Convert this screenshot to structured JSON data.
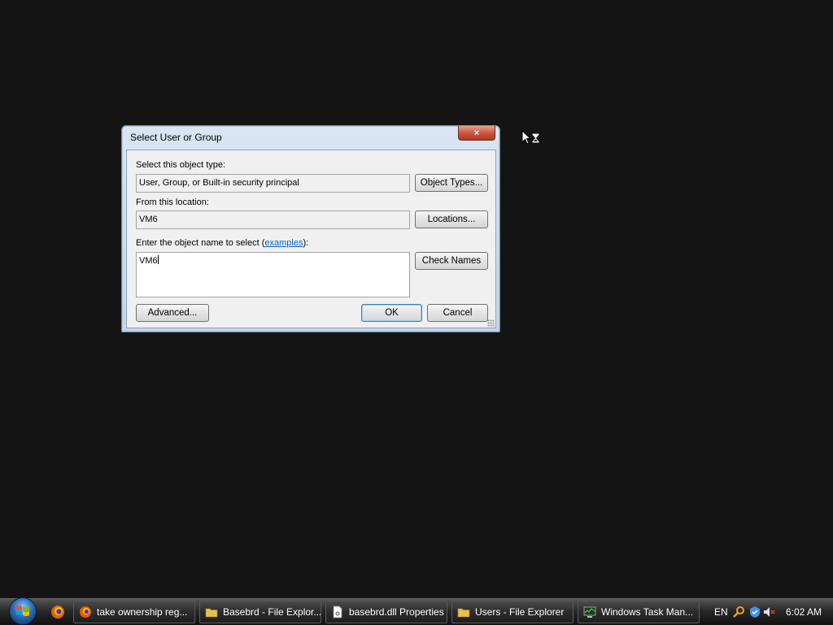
{
  "dialog": {
    "title": "Select User or Group",
    "close_label": "×",
    "object_type_label": "Select this object type:",
    "object_type_value": "User, Group, or Built-in security principal",
    "object_types_button": "Object Types...",
    "location_label": "From this location:",
    "location_value": "VM6",
    "locations_button": "Locations...",
    "enter_name_prefix": "Enter the object name to select (",
    "examples_link": "examples",
    "enter_name_suffix": "):",
    "object_name_value": "VM6",
    "check_names_button": "Check Names",
    "advanced_button": "Advanced...",
    "ok_button": "OK",
    "cancel_button": "Cancel"
  },
  "taskbar": {
    "items": [
      {
        "label": "take ownership reg...",
        "icon": "firefox-icon"
      },
      {
        "label": "Basebrd - File Explor...",
        "icon": "folder-icon"
      },
      {
        "label": "basebrd.dll Properties",
        "icon": "file-icon"
      },
      {
        "label": "Users - File Explorer",
        "icon": "folder-icon"
      },
      {
        "label": "Windows Task Man...",
        "icon": "task-manager-icon"
      }
    ],
    "tray": {
      "language": "EN",
      "time": "6:02 AM"
    }
  },
  "colors": {
    "desktop": "#141414",
    "dialog_frame": "#c3d6ea",
    "close_button": "#c8523c",
    "link": "#0066cc"
  }
}
